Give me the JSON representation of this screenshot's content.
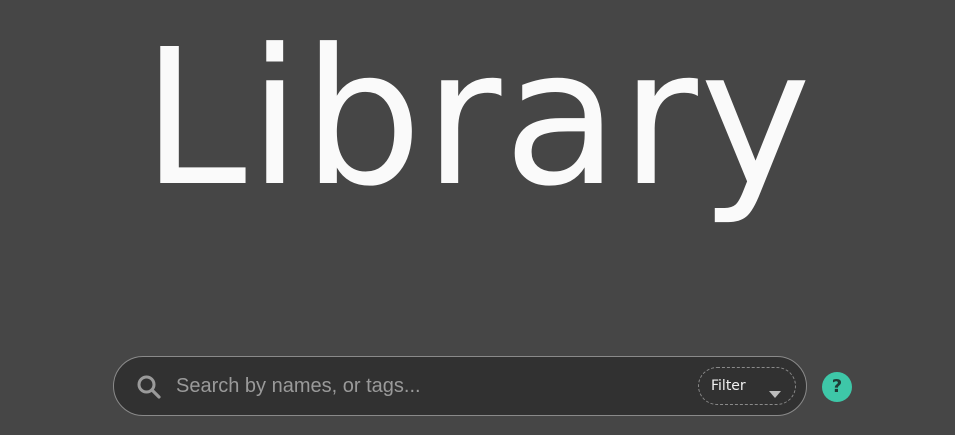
{
  "page": {
    "title": "Library"
  },
  "search": {
    "placeholder": "Search by names, or tags...",
    "value": "",
    "icon": "search-icon"
  },
  "filter": {
    "label": "Filter",
    "icon": "chevron-down-icon"
  },
  "help": {
    "glyph": "?",
    "icon": "help-icon"
  },
  "colors": {
    "background": "#464646",
    "search_bar": "#313131",
    "accent": "#3ec7a8",
    "title": "#fafafa"
  }
}
